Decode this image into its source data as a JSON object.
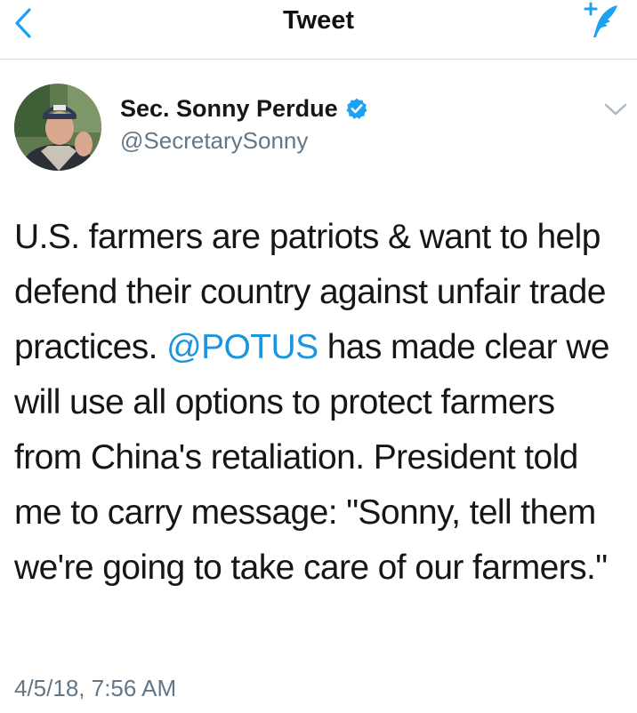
{
  "nav": {
    "title": "Tweet",
    "back_icon": "chevron-left-icon",
    "compose_icon": "compose-tweet-icon",
    "accent_color": "#1da1f2"
  },
  "author": {
    "name": "Sec. Sonny Perdue",
    "handle": "@SecretarySonny",
    "verified_icon": "verified-badge-icon",
    "menu_icon": "chevron-down-icon"
  },
  "tweet": {
    "text_before_mention": "U.S. farmers are patriots & want to help defend their country against unfair trade practices. ",
    "mention": "@POTUS",
    "text_after_mention": " has made clear we will use all options to protect farmers from China's retaliation. President told me to carry message: \"Sonny, tell them we're going to take care of our farmers.\"",
    "timestamp": "4/5/18, 7:56 AM",
    "mention_color": "#1b95e0"
  }
}
